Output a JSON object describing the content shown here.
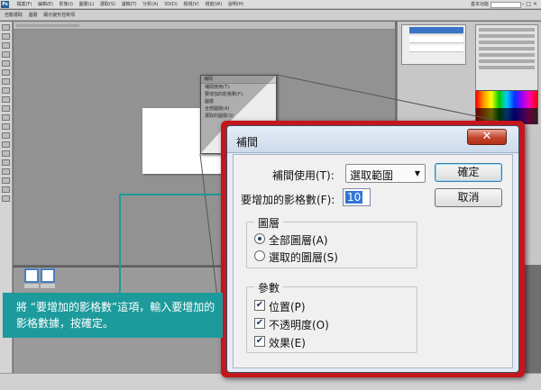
{
  "photoshop": {
    "logo": "Ps",
    "menu": [
      "檔案(F)",
      "編輯(E)",
      "影像(I)",
      "圖層(L)",
      "選取(S)",
      "濾鏡(T)",
      "分析(A)",
      "3D(D)",
      "檢視(V)",
      "視窗(W)",
      "說明(H)"
    ],
    "workspace_label": "基本功能",
    "options": [
      "自動選取",
      "圖層",
      "顯示變形控制項"
    ]
  },
  "dialog": {
    "title": "補間",
    "close_glyph": "✕",
    "interpolate_label": "補間使用(T):",
    "interpolate_value": "選取範圍",
    "select_arrow": "▼",
    "frames_label": "要增加的影格數(F):",
    "frames_value": "10",
    "ok_label": "確定",
    "cancel_label": "取消",
    "layers_group": {
      "title": "圖層",
      "all_layers": "全部圖層(A)",
      "selected_layers": "選取的圖層(S)",
      "selected": "all_layers"
    },
    "params_group": {
      "title": "參數",
      "position": "位置(P)",
      "opacity": "不透明度(O)",
      "effects": "效果(E)",
      "check_glyph": "✔"
    }
  },
  "mini_dialog": {
    "title": "補間",
    "interpolate_label": "補間使用(T):",
    "frames_label": "要增加的影格數(F):",
    "layers_title": "圖層",
    "all_layers": "全部圖層(A)",
    "selected_layers": "選取的圖層(S)"
  },
  "callout": {
    "text": "將 “要增加的影格數”這項，輸入要增加的影格數據，按確定。"
  },
  "colors": {
    "highlight_frame": "#c4161c",
    "callout": "#1d9a9c"
  }
}
